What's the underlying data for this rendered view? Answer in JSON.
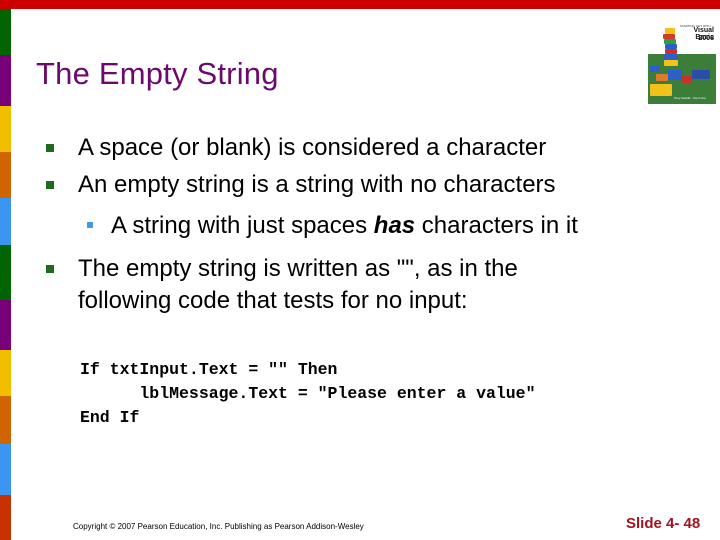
{
  "slide": {
    "title": "The Empty String",
    "bullets": [
      {
        "level": 1,
        "text": "A space (or blank) is considered a character"
      },
      {
        "level": 1,
        "text": "An empty string is a string with no characters"
      },
      {
        "level": 2,
        "text_before": "A string with just spaces ",
        "text_emphasis": "has",
        "text_after": " characters in it"
      },
      {
        "level": 1,
        "line1": "The empty string is written as \"\", as in the",
        "line2": "following code that tests for no input:"
      }
    ],
    "code_lines": [
      "If txtInput.Text = \"\" Then",
      "      lblMessage.Text = \"Please enter a value\"",
      "End If"
    ],
    "footer": {
      "copyright": "Copyright © 2007 Pearson Education, Inc. Publishing as Pearson Addison-Wesley",
      "slide_number": "Slide 4- 48"
    },
    "book_cover": {
      "series": "STARTING OUT WITH",
      "title": "Visual Basic",
      "year": "2008",
      "authors": "Tony Gaddis · Kip Irvine"
    }
  },
  "colors": {
    "top_bar": "#CC0000",
    "title": "#6B0A6E",
    "bullet_level1": "#1E6B1E",
    "bullet_level2": "#3D9BE9",
    "slide_number": "#A3121E",
    "stripes": [
      "#006400",
      "#780078",
      "#F2BF00",
      "#D06400",
      "#3A96F0",
      "#006400",
      "#780078",
      "#F2BF00",
      "#D06400",
      "#3A96F0",
      "#C83200"
    ]
  }
}
